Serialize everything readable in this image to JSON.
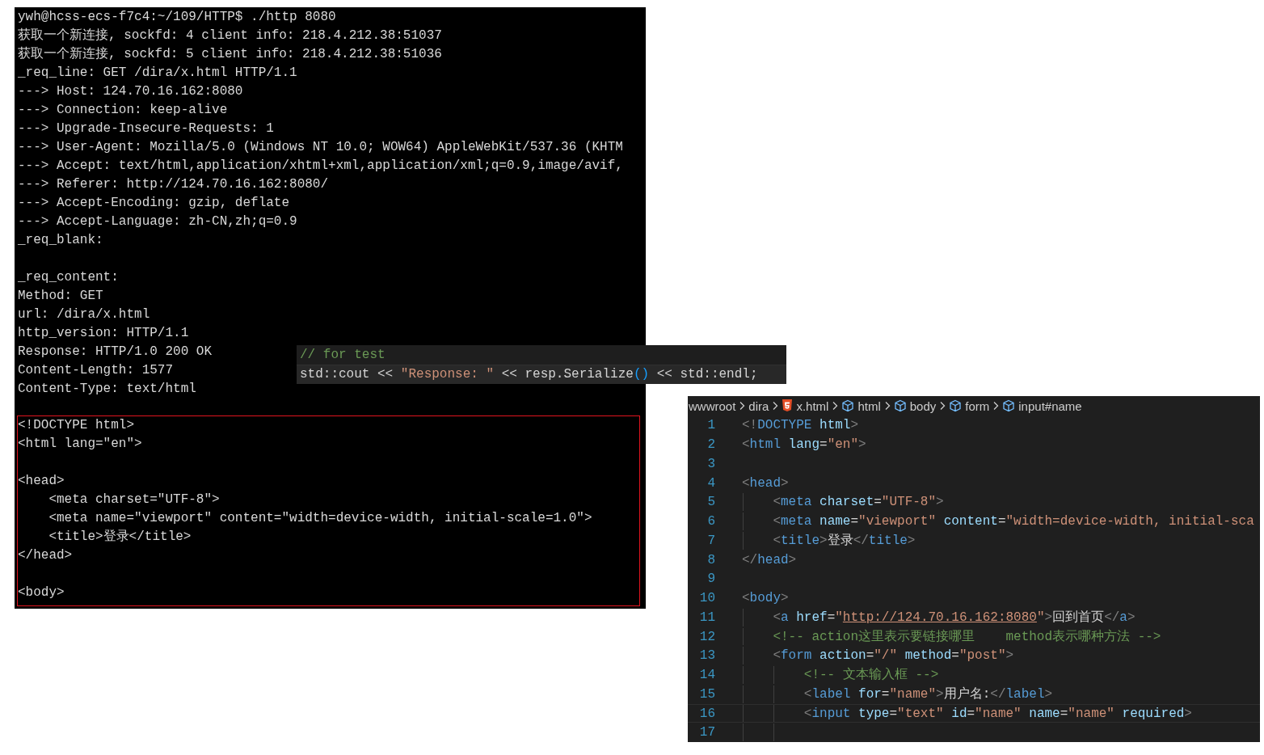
{
  "terminal": {
    "sections": [
      {
        "boxed": false,
        "paragraphs": [
          [
            "ywh@hcss-ecs-f7c4:~/109/HTTP$ ./http 8080",
            "获取一个新连接, sockfd: 4 client info: 218.4.212.38:51037",
            "获取一个新连接, sockfd: 5 client info: 218.4.212.38:51036",
            "_req_line: GET /dira/x.html HTTP/1.1",
            "---> Host: 124.70.16.162:8080",
            "---> Connection: keep-alive",
            "---> Upgrade-Insecure-Requests: 1",
            "---> User-Agent: Mozilla/5.0 (Windows NT 10.0; WOW64) AppleWebKit/537.36 (KHTM",
            "---> Accept: text/html,application/xhtml+xml,application/xml;q=0.9,image/avif,",
            "---> Referer: http://124.70.16.162:8080/",
            "---> Accept-Encoding: gzip, deflate",
            "---> Accept-Language: zh-CN,zh;q=0.9",
            "_req_blank:"
          ],
          [
            "_req_content:",
            "Method: GET",
            "url: /dira/x.html",
            "http_version: HTTP/1.1",
            "Response: HTTP/1.0 200 OK",
            "Content-Length: 1577",
            "Content-Type: text/html"
          ]
        ]
      },
      {
        "boxed": true,
        "paragraphs": [
          [
            "<!DOCTYPE html>",
            "<html lang=\"en\">"
          ],
          [
            "<head>",
            "    <meta charset=\"UTF-8\">",
            "    <meta name=\"viewport\" content=\"width=device-width, initial-scale=1.0\">",
            "    <title>登录</title>",
            "</head>"
          ],
          [
            "<body>"
          ]
        ]
      }
    ]
  },
  "snippet": {
    "lines": [
      {
        "current": false,
        "tokens": [
          {
            "kind": "comment",
            "t": "// for test"
          }
        ]
      },
      {
        "current": true,
        "tokens": [
          {
            "kind": "text",
            "t": "std::cout << "
          },
          {
            "kind": "str",
            "t": "\"Response: \""
          },
          {
            "kind": "text",
            "t": " << resp.Serialize"
          },
          {
            "kind": "paren",
            "t": "()"
          },
          {
            "kind": "text",
            "t": " << std::endl;"
          }
        ]
      }
    ]
  },
  "editor": {
    "breadcrumbs": [
      {
        "kind": "folder",
        "label": "wwwroot"
      },
      {
        "kind": "folder",
        "label": "dira"
      },
      {
        "kind": "html5",
        "label": "x.html"
      },
      {
        "kind": "symbol",
        "label": "html"
      },
      {
        "kind": "symbol",
        "label": "body"
      },
      {
        "kind": "symbol",
        "label": "form"
      },
      {
        "kind": "symbol",
        "label": "input#name"
      }
    ],
    "lines": [
      {
        "number": "1",
        "current": false,
        "tokens": [
          {
            "kind": "punct",
            "t": "<!"
          },
          {
            "kind": "tag",
            "t": "DOCTYPE"
          },
          {
            "kind": "attr",
            "t": " html"
          },
          {
            "kind": "punct",
            "t": ">"
          }
        ]
      },
      {
        "number": "2",
        "current": false,
        "tokens": [
          {
            "kind": "punct",
            "t": "<"
          },
          {
            "kind": "tag",
            "t": "html"
          },
          {
            "kind": "attr",
            "t": " lang"
          },
          {
            "kind": "text",
            "t": "="
          },
          {
            "kind": "str",
            "t": "\"en\""
          },
          {
            "kind": "punct",
            "t": ">"
          }
        ]
      },
      {
        "number": "3",
        "current": false
      },
      {
        "number": "4",
        "current": false,
        "tokens": [
          {
            "kind": "punct",
            "t": "<"
          },
          {
            "kind": "tag",
            "t": "head"
          },
          {
            "kind": "punct",
            "t": ">"
          }
        ]
      },
      {
        "number": "5",
        "current": false,
        "tokens": [
          {
            "kind": "punct",
            "t": "    <"
          },
          {
            "kind": "tag",
            "t": "meta"
          },
          {
            "kind": "attr",
            "t": " charset"
          },
          {
            "kind": "text",
            "t": "="
          },
          {
            "kind": "str",
            "t": "\"UTF-8\""
          },
          {
            "kind": "punct",
            "t": ">"
          }
        ]
      },
      {
        "number": "6",
        "current": false,
        "tokens": [
          {
            "kind": "punct",
            "t": "    <"
          },
          {
            "kind": "tag",
            "t": "meta"
          },
          {
            "kind": "attr",
            "t": " name"
          },
          {
            "kind": "text",
            "t": "="
          },
          {
            "kind": "str",
            "t": "\"viewport\""
          },
          {
            "kind": "attr",
            "t": " content"
          },
          {
            "kind": "text",
            "t": "="
          },
          {
            "kind": "str",
            "t": "\"width=device-width, initial-sca"
          }
        ]
      },
      {
        "number": "7",
        "current": false,
        "tokens": [
          {
            "kind": "punct",
            "t": "    <"
          },
          {
            "kind": "tag",
            "t": "title"
          },
          {
            "kind": "punct",
            "t": ">"
          },
          {
            "kind": "text",
            "t": "登录"
          },
          {
            "kind": "punct",
            "t": "</"
          },
          {
            "kind": "tag",
            "t": "title"
          },
          {
            "kind": "punct",
            "t": ">"
          }
        ]
      },
      {
        "number": "8",
        "current": false,
        "tokens": [
          {
            "kind": "punct",
            "t": "</"
          },
          {
            "kind": "tag",
            "t": "head"
          },
          {
            "kind": "punct",
            "t": ">"
          }
        ]
      },
      {
        "number": "9",
        "current": false
      },
      {
        "number": "10",
        "current": false,
        "tokens": [
          {
            "kind": "punct",
            "t": "<"
          },
          {
            "kind": "tag",
            "t": "body"
          },
          {
            "kind": "punct",
            "t": ">"
          }
        ]
      },
      {
        "number": "11",
        "current": false,
        "tokens": [
          {
            "kind": "punct",
            "t": "    <"
          },
          {
            "kind": "tag",
            "t": "a"
          },
          {
            "kind": "attr",
            "t": " href"
          },
          {
            "kind": "text",
            "t": "="
          },
          {
            "kind": "str",
            "t": "\""
          },
          {
            "kind": "link",
            "t": "http://124.70.16.162:8080"
          },
          {
            "kind": "str",
            "t": "\""
          },
          {
            "kind": "punct",
            "t": ">"
          },
          {
            "kind": "text",
            "t": "回到首页"
          },
          {
            "kind": "punct",
            "t": "</"
          },
          {
            "kind": "tag",
            "t": "a"
          },
          {
            "kind": "punct",
            "t": ">"
          }
        ]
      },
      {
        "number": "12",
        "current": false,
        "tokens": [
          {
            "kind": "comment",
            "t": "    <!-- action这里表示要链接哪里    method表示哪种方法 -->"
          }
        ]
      },
      {
        "number": "13",
        "current": false,
        "tokens": [
          {
            "kind": "punct",
            "t": "    <"
          },
          {
            "kind": "tag",
            "t": "form"
          },
          {
            "kind": "attr",
            "t": " action"
          },
          {
            "kind": "text",
            "t": "="
          },
          {
            "kind": "str",
            "t": "\"/\""
          },
          {
            "kind": "attr",
            "t": " method"
          },
          {
            "kind": "text",
            "t": "="
          },
          {
            "kind": "str",
            "t": "\"post\""
          },
          {
            "kind": "punct",
            "t": ">"
          }
        ]
      },
      {
        "number": "14",
        "current": false,
        "tokens": [
          {
            "kind": "comment",
            "t": "        <!-- 文本输入框 -->"
          }
        ]
      },
      {
        "number": "15",
        "current": false,
        "tokens": [
          {
            "kind": "punct",
            "t": "        <"
          },
          {
            "kind": "tag",
            "t": "label"
          },
          {
            "kind": "attr",
            "t": " for"
          },
          {
            "kind": "text",
            "t": "="
          },
          {
            "kind": "str",
            "t": "\"name\""
          },
          {
            "kind": "punct",
            "t": ">"
          },
          {
            "kind": "text",
            "t": "用户名:"
          },
          {
            "kind": "punct",
            "t": "</"
          },
          {
            "kind": "tag",
            "t": "label"
          },
          {
            "kind": "punct",
            "t": ">"
          }
        ]
      },
      {
        "number": "16",
        "current": true,
        "tokens": [
          {
            "kind": "punct",
            "t": "        <"
          },
          {
            "kind": "tag",
            "t": "input"
          },
          {
            "kind": "attr",
            "t": " type"
          },
          {
            "kind": "text",
            "t": "="
          },
          {
            "kind": "str",
            "t": "\"text\""
          },
          {
            "kind": "attr",
            "t": " id"
          },
          {
            "kind": "text",
            "t": "="
          },
          {
            "kind": "str",
            "t": "\"name\""
          },
          {
            "kind": "attr",
            "t": " name"
          },
          {
            "kind": "text",
            "t": "="
          },
          {
            "kind": "str",
            "t": "\"name\""
          },
          {
            "kind": "attr",
            "t": " required"
          },
          {
            "kind": "punct",
            "t": ">"
          }
        ]
      },
      {
        "number": "17",
        "current": false
      }
    ]
  }
}
